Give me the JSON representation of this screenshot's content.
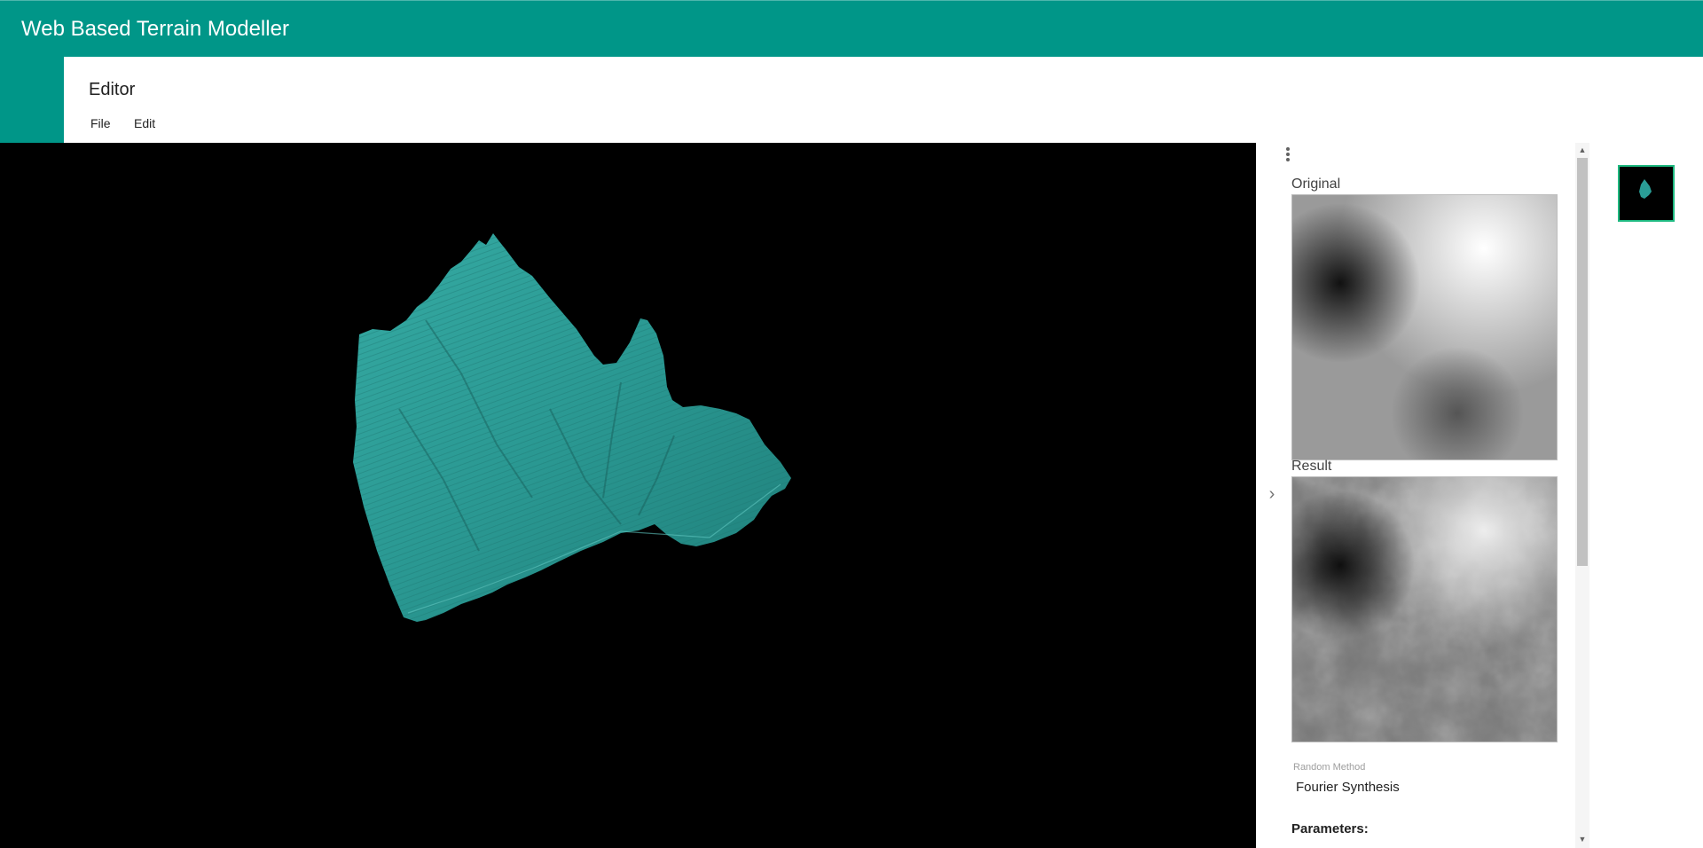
{
  "app": {
    "title": "Web Based Terrain Modeller"
  },
  "editor": {
    "title": "Editor",
    "menu": [
      {
        "label": "File"
      },
      {
        "label": "Edit"
      }
    ]
  },
  "panel": {
    "original_label": "Original",
    "result_label": "Result",
    "random_method": {
      "label": "Random Method",
      "value": "Fourier Synthesis"
    },
    "parameters_label": "Parameters:"
  },
  "icons": {
    "more": "more-vert-icon",
    "chevron": "chevron-right-icon"
  },
  "colors": {
    "appbar": "#009688",
    "terrain": "#2a9d96",
    "thumbnail_border": "#1eb980"
  }
}
